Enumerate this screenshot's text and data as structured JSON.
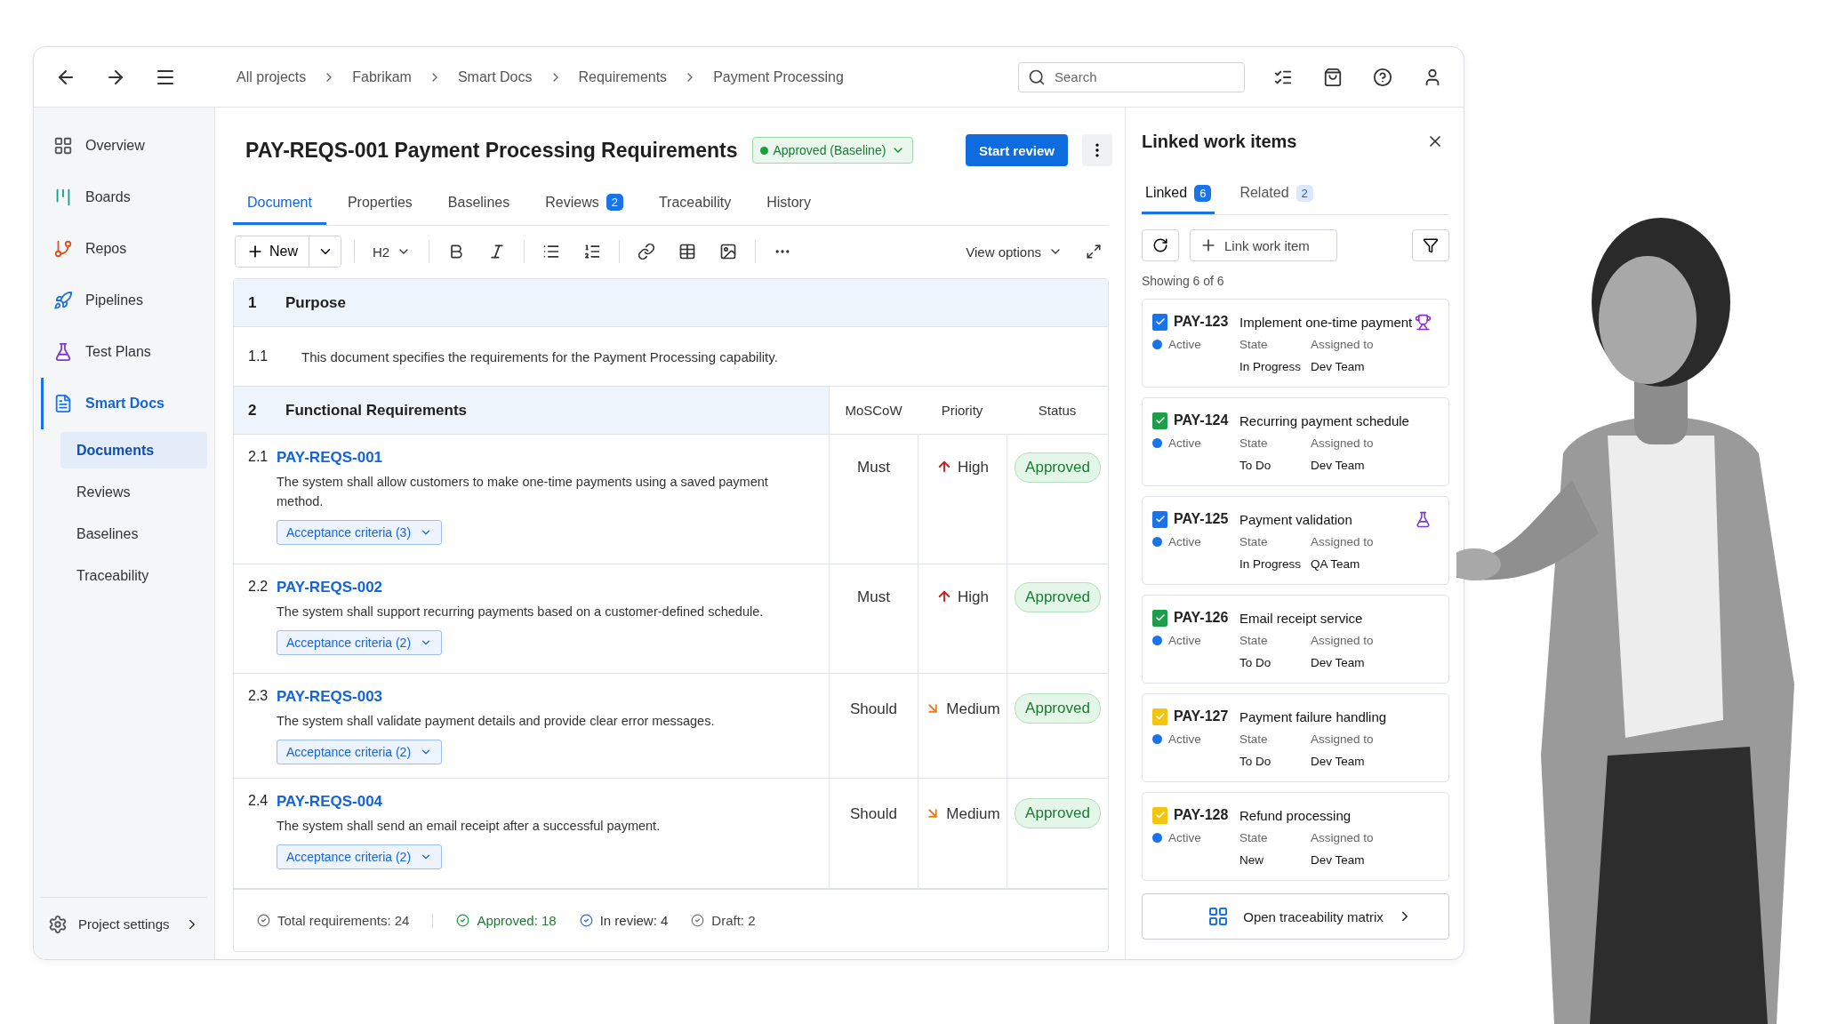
{
  "header": {
    "breadcrumbs": [
      "All projects",
      "Fabrikam",
      "Smart Docs",
      "Requirements",
      "Payment Processing"
    ],
    "search": {
      "placeholder": "Search"
    }
  },
  "sidebar": {
    "items": [
      {
        "label": "Overview",
        "selected": false
      },
      {
        "label": "Boards",
        "selected": false
      },
      {
        "label": "Repos",
        "selected": false
      },
      {
        "label": "Pipelines",
        "selected": false
      },
      {
        "label": "Test Plans",
        "selected": false
      },
      {
        "label": "Smart Docs",
        "selected": true,
        "children": [
          {
            "label": "Documents",
            "selected": true
          },
          {
            "label": "Reviews",
            "selected": false
          },
          {
            "label": "Baselines",
            "selected": false
          },
          {
            "label": "Traceability",
            "selected": false
          }
        ]
      }
    ],
    "settings": "Project settings"
  },
  "document": {
    "title": "PAY-REQS-001 Payment Processing Requirements",
    "status": "Approved (Baseline)",
    "primary_button": "Start review",
    "tabs": [
      {
        "label": "Document",
        "selected": true
      },
      {
        "label": "Properties",
        "selected": false
      },
      {
        "label": "Baselines",
        "selected": false
      },
      {
        "label": "Reviews",
        "selected": false,
        "count": "2"
      },
      {
        "label": "Traceability",
        "selected": false
      },
      {
        "label": "History",
        "selected": false
      }
    ],
    "toolbar": {
      "new": "New",
      "heading": "H2",
      "view_options": "View options"
    },
    "sections": [
      {
        "number": "1",
        "title": "Purpose",
        "rows": [
          {
            "number": "1.1",
            "text": "This document specifies the requirements for the Payment Processing capability."
          }
        ]
      },
      {
        "number": "2",
        "title": "Functional Requirements",
        "columns": [
          "MoSCoW",
          "Priority",
          "Status"
        ],
        "requirements": [
          {
            "number": "2.1",
            "id": "PAY-REQS-001",
            "text": "The system shall allow customers to make one-time payments using a saved payment method.",
            "criteria": "Acceptance criteria (3)",
            "moscow": "Must",
            "priority": "High",
            "kind": "high",
            "status": "Approved"
          },
          {
            "number": "2.2",
            "id": "PAY-REQS-002",
            "text": "The system shall support recurring payments based on a customer-defined schedule.",
            "criteria": "Acceptance criteria (2)",
            "moscow": "Must",
            "priority": "High",
            "kind": "high",
            "status": "Approved"
          },
          {
            "number": "2.3",
            "id": "PAY-REQS-003",
            "text": "The system shall validate payment details and provide clear error messages.",
            "criteria": "Acceptance criteria (2)",
            "moscow": "Should",
            "priority": "Medium",
            "kind": "medium",
            "status": "Approved"
          },
          {
            "number": "2.4",
            "id": "PAY-REQS-004",
            "text": "The system shall send an email receipt after a successful payment.",
            "criteria": "Acceptance criteria (2)",
            "moscow": "Should",
            "priority": "Medium",
            "kind": "medium",
            "status": "Approved"
          }
        ]
      }
    ],
    "stats": [
      {
        "kind": "total",
        "label": "Total requirements: 24"
      },
      {
        "kind": "approved",
        "label": "Approved: 18"
      },
      {
        "kind": "review",
        "label": "In review: 4"
      },
      {
        "kind": "draft",
        "label": "Draft: 2"
      }
    ]
  },
  "panel": {
    "title": "Linked work items",
    "tabs": [
      {
        "label": "Linked",
        "count": "6",
        "selected": true
      },
      {
        "label": "Related",
        "count": "2",
        "selected": false
      }
    ],
    "link_button": "Link work item",
    "showing": "Showing 6 of 6",
    "cards": [
      {
        "id": "PAY-123",
        "title": "Implement one-time payment",
        "color": "#1a73e8",
        "status": "Active",
        "state_label": "State",
        "state": "In Progress",
        "assigned_label": "Assigned to",
        "assignee": "Dev Team",
        "kind": "trophy"
      },
      {
        "id": "PAY-124",
        "title": "Recurring payment schedule",
        "color": "#1e9e4a",
        "status": "Active",
        "state_label": "State",
        "state": "To Do",
        "assigned_label": "Assigned to",
        "assignee": "Dev Team"
      },
      {
        "id": "PAY-125",
        "title": "Payment validation",
        "color": "#1a73e8",
        "status": "Active",
        "state_label": "State",
        "state": "In Progress",
        "assigned_label": "Assigned to",
        "assignee": "QA Team",
        "kind": "flask"
      },
      {
        "id": "PAY-126",
        "title": "Email receipt service",
        "color": "#1e9e4a",
        "status": "Active",
        "state_label": "State",
        "state": "To Do",
        "assigned_label": "Assigned to",
        "assignee": "Dev Team"
      },
      {
        "id": "PAY-127",
        "title": "Payment failure handling",
        "color": "#f2c511",
        "status": "Active",
        "state_label": "State",
        "state": "To Do",
        "assigned_label": "Assigned to",
        "assignee": "Dev Team"
      },
      {
        "id": "PAY-128",
        "title": "Refund processing",
        "color": "#f2c511",
        "status": "Active",
        "state_label": "State",
        "state": "New",
        "assigned_label": "Assigned to",
        "assignee": "Dev Team"
      }
    ],
    "footer_button": "Open traceability matrix"
  }
}
